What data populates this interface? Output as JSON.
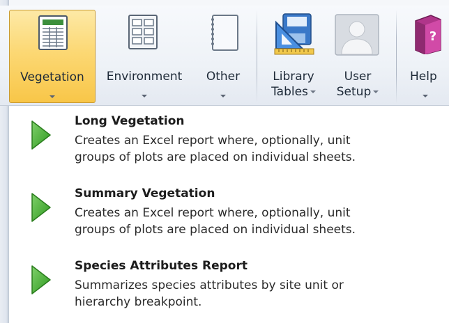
{
  "ribbon": {
    "buttons": [
      {
        "label": "Vegetation",
        "icon": "report-sheet-icon",
        "has_dropdown": true,
        "active": true
      },
      {
        "label": "Environment",
        "icon": "report-grid-icon",
        "has_dropdown": true,
        "active": false
      },
      {
        "label": "Other",
        "icon": "blank-notebook-icon",
        "has_dropdown": true,
        "active": false
      },
      {
        "label_line1": "Library",
        "label_line2": "Tables",
        "icon": "library-tables-icon",
        "has_dropdown": true
      },
      {
        "label_line1": "User",
        "label_line2": "Setup",
        "icon": "user-silhouette-icon",
        "has_dropdown": true
      },
      {
        "label": "Help",
        "icon": "help-book-icon",
        "has_dropdown": true
      }
    ]
  },
  "menu": {
    "items": [
      {
        "title": "Long Vegetation",
        "desc_line1": "Creates an Excel report where, optionally, unit",
        "desc_line2": "groups of plots are placed on individual sheets.",
        "icon": "play-arrow-icon"
      },
      {
        "title": "Summary Vegetation",
        "desc_line1": "Creates an Excel report where, optionally, unit",
        "desc_line2": "groups of plots are placed on individual sheets.",
        "icon": "play-arrow-icon"
      },
      {
        "title": "Species Attributes Report",
        "desc_line1": "Summarizes species attributes by site unit or",
        "desc_line2": "hierarchy breakpoint.",
        "icon": "play-arrow-icon"
      }
    ]
  },
  "colors": {
    "active_button_top": "#fde9a6",
    "active_button_bottom": "#f8c648",
    "play_green": "#3fae2a",
    "ribbon_bg": "#eef2f7"
  }
}
